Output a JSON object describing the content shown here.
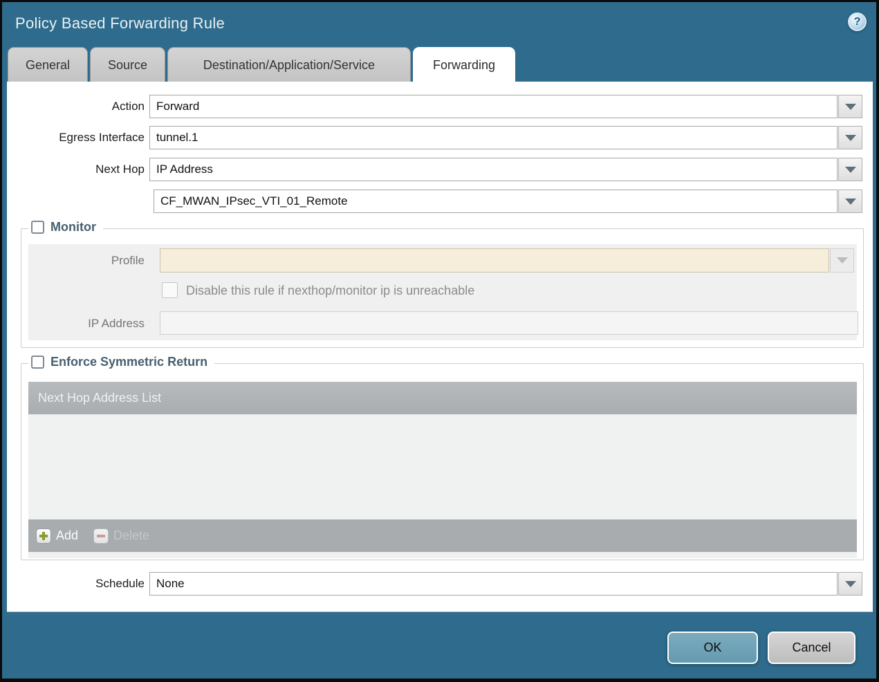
{
  "dialog": {
    "title": "Policy Based Forwarding Rule",
    "help_glyph": "?"
  },
  "tabs": [
    {
      "label": "General",
      "active": false
    },
    {
      "label": "Source",
      "active": false
    },
    {
      "label": "Destination/Application/Service",
      "active": false
    },
    {
      "label": "Forwarding",
      "active": true
    }
  ],
  "fields": {
    "action": {
      "label": "Action",
      "value": "Forward"
    },
    "egress_interface": {
      "label": "Egress Interface",
      "value": "tunnel.1"
    },
    "next_hop": {
      "label": "Next Hop",
      "value": "IP Address"
    },
    "next_hop_address": {
      "value": "CF_MWAN_IPsec_VTI_01_Remote"
    },
    "schedule": {
      "label": "Schedule",
      "value": "None"
    }
  },
  "monitor": {
    "legend": "Monitor",
    "checked": false,
    "profile": {
      "label": "Profile",
      "value": ""
    },
    "disable_rule": {
      "label": "Disable this rule if nexthop/monitor ip is unreachable",
      "checked": false
    },
    "ip_address": {
      "label": "IP Address",
      "value": ""
    }
  },
  "enforce_symmetric_return": {
    "legend": "Enforce Symmetric Return",
    "checked": false,
    "table": {
      "header": "Next Hop Address List",
      "rows": []
    },
    "toolbar": {
      "add_label": "Add",
      "delete_label": "Delete",
      "delete_enabled": false
    }
  },
  "footer": {
    "ok_label": "OK",
    "cancel_label": "Cancel"
  },
  "colors": {
    "frame_teal": "#2e6b8c",
    "inactive_tab": "#c9c9c9",
    "disabled_profile_bg": "#f6eedb",
    "table_header_bg": "#aeb2b5",
    "ok_button_bg": "#6fa3b6",
    "cancel_button_bg": "#c9c9c9",
    "add_icon_green": "#8d9b31",
    "delete_icon_red": "#d09a9a",
    "legend_text": "#46606f"
  }
}
